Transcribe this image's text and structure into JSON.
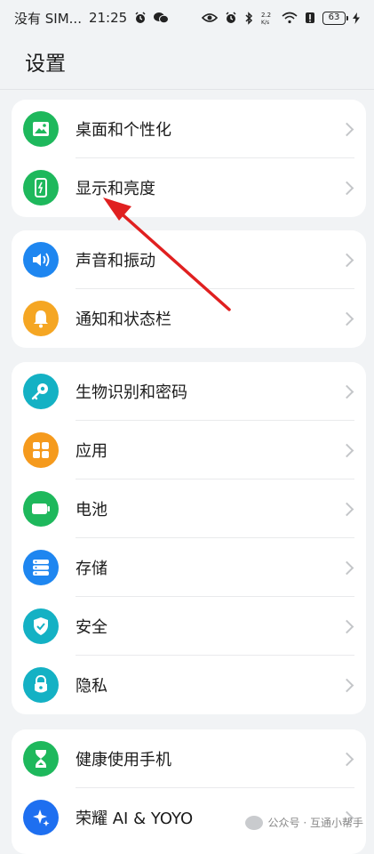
{
  "status_bar": {
    "carrier": "没有 SIM...",
    "time": "21:25",
    "battery": "63"
  },
  "page_title": "设置",
  "groups": [
    {
      "items": [
        {
          "label": "桌面和个性化",
          "icon": "wallpaper-icon",
          "color": "#1eb85c"
        },
        {
          "label": "显示和亮度",
          "icon": "phone-brightness-icon",
          "color": "#1eb85c"
        }
      ]
    },
    {
      "items": [
        {
          "label": "声音和振动",
          "icon": "speaker-icon",
          "color": "#1e86f0"
        },
        {
          "label": "通知和状态栏",
          "icon": "bell-icon",
          "color": "#f5a623"
        }
      ]
    },
    {
      "items": [
        {
          "label": "生物识别和密码",
          "icon": "key-icon",
          "color": "#14b1c4"
        },
        {
          "label": "应用",
          "icon": "apps-grid-icon",
          "color": "#f59a1d"
        },
        {
          "label": "电池",
          "icon": "battery-icon",
          "color": "#1eb85c"
        },
        {
          "label": "存储",
          "icon": "storage-icon",
          "color": "#1e86f0"
        },
        {
          "label": "安全",
          "icon": "shield-check-icon",
          "color": "#14b1c4"
        },
        {
          "label": "隐私",
          "icon": "privacy-lock-icon",
          "color": "#14b1c4"
        }
      ]
    },
    {
      "items": [
        {
          "label": "健康使用手机",
          "icon": "hourglass-icon",
          "color": "#1eb85c"
        },
        {
          "label": "荣耀 AI & YOYO",
          "icon": "ai-sparkle-icon",
          "color": "#1e6ff0"
        }
      ]
    }
  ],
  "watermark": "公众号 · 互通小帮手",
  "annotation_color": "#e02020"
}
